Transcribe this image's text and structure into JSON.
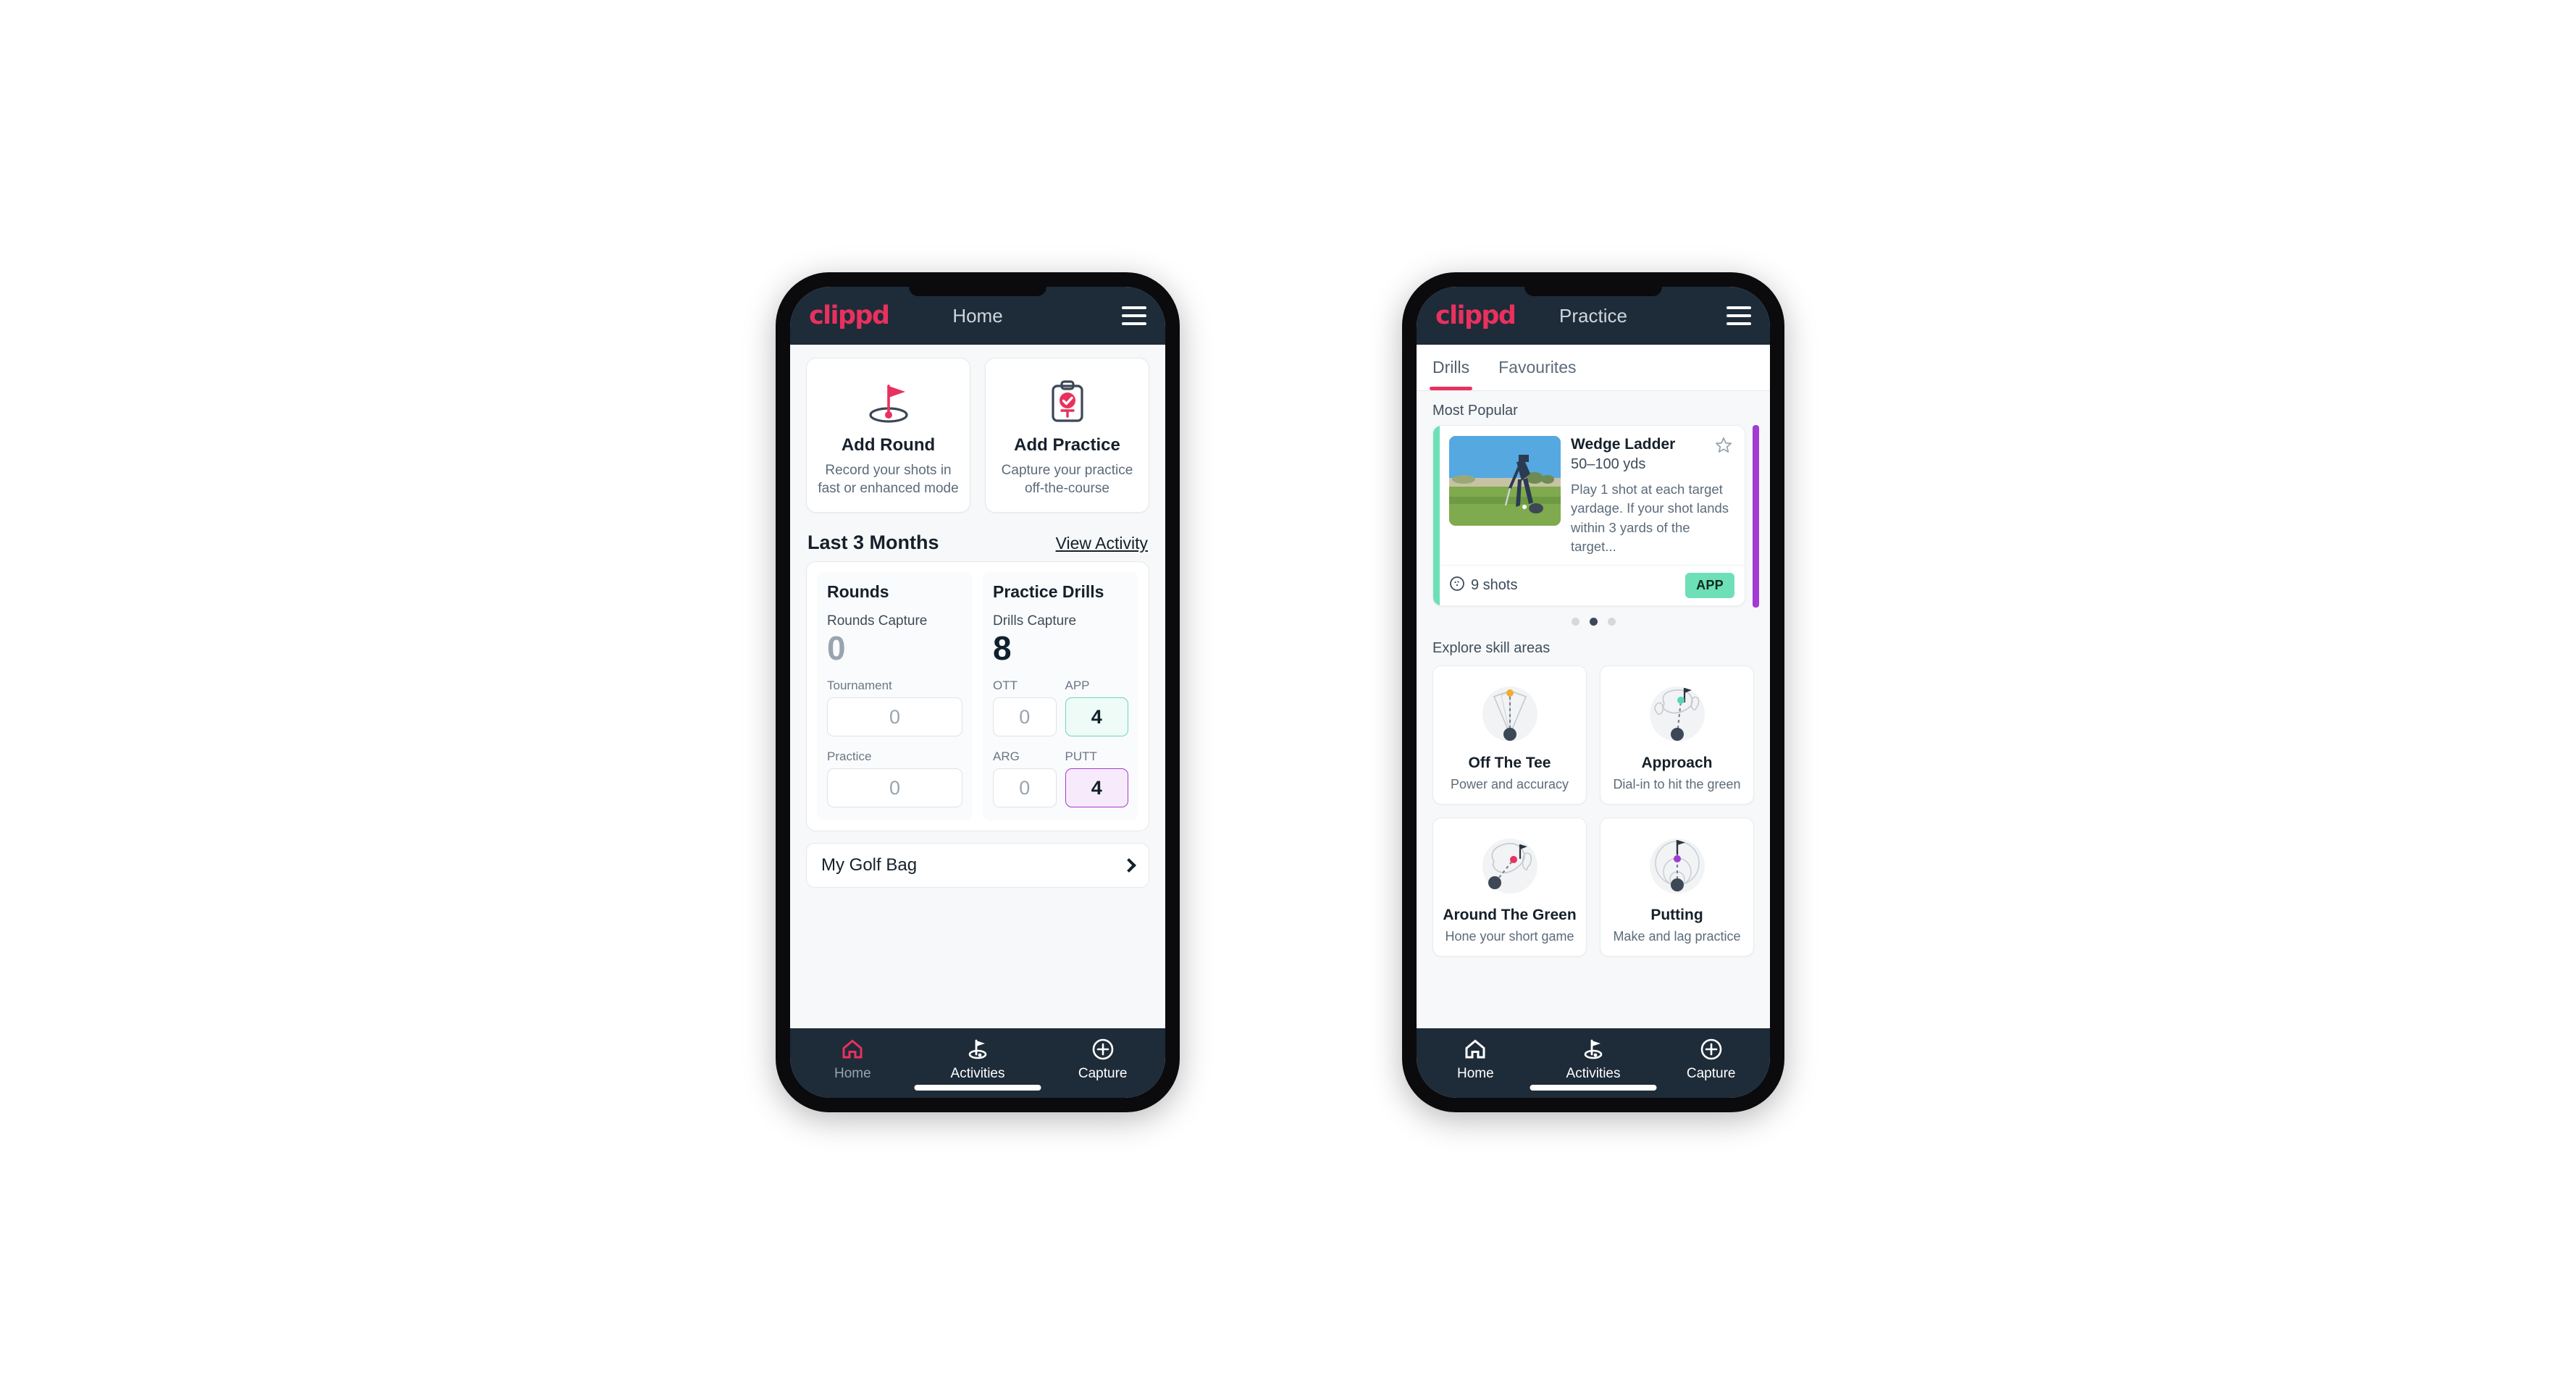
{
  "theme": {
    "brand_pink": "#e8315e",
    "navy": "#1e2b38",
    "app_green": "#6ee0b8",
    "putt_purple": "#a23bd4",
    "page_bg": "#ffffff"
  },
  "phone_home": {
    "appbar": {
      "logo": "clippd",
      "title": "Home",
      "menu_icon": "hamburger-menu-icon"
    },
    "actions": [
      {
        "icon": "golf-flag-hole-icon",
        "title": "Add Round",
        "subtitle": "Record your shots in fast or enhanced mode"
      },
      {
        "icon": "clipboard-check-icon",
        "title": "Add Practice",
        "subtitle": "Capture your practice off-the-course"
      }
    ],
    "section": {
      "title": "Last 3 Months",
      "link": "View Activity"
    },
    "rounds": {
      "heading": "Rounds",
      "capture_label": "Rounds Capture",
      "capture_value": "0",
      "fields": [
        {
          "label": "Tournament",
          "value": "0",
          "style": "plain"
        },
        {
          "label": "Practice",
          "value": "0",
          "style": "plain"
        }
      ]
    },
    "drills": {
      "heading": "Practice Drills",
      "capture_label": "Drills Capture",
      "capture_value": "8",
      "fields": [
        {
          "label": "OTT",
          "value": "0",
          "style": "plain"
        },
        {
          "label": "APP",
          "value": "4",
          "style": "app"
        },
        {
          "label": "ARG",
          "value": "0",
          "style": "plain"
        },
        {
          "label": "PUTT",
          "value": "4",
          "style": "putt"
        }
      ]
    },
    "golf_bag": {
      "label": "My Golf Bag",
      "chevron_icon": "chevron-right-icon"
    },
    "bottom_nav": [
      {
        "label": "Home",
        "icon": "home-icon",
        "active": true
      },
      {
        "label": "Activities",
        "icon": "golf-flag-icon",
        "active": false
      },
      {
        "label": "Capture",
        "icon": "plus-circle-icon",
        "active": false
      }
    ]
  },
  "phone_practice": {
    "appbar": {
      "logo": "clippd",
      "title": "Practice",
      "menu_icon": "hamburger-menu-icon"
    },
    "tabs": [
      {
        "label": "Drills",
        "active": true
      },
      {
        "label": "Favourites",
        "active": false
      }
    ],
    "most_popular_label": "Most Popular",
    "drill_card": {
      "accent_color": "#6ee0b8",
      "thumbnail": "golfer-chipping-photo",
      "name": "Wedge Ladder",
      "yardage": "50–100 yds",
      "description": "Play 1 shot at each target yardage. If your shot lands within 3 yards of the target...",
      "star_icon": "star-outline-icon",
      "shots_icon": "golf-ball-icon",
      "shots": "9 shots",
      "badge": "APP",
      "next_card_accent": "#a23bd4"
    },
    "carousel_dots": {
      "count": 3,
      "active_index": 1
    },
    "explore_label": "Explore skill areas",
    "skill_areas": [
      {
        "icon": "tee-shot-dispersion-icon",
        "title": "Off The Tee",
        "subtitle": "Power and accuracy",
        "dot_color": "#f0ad2e"
      },
      {
        "icon": "approach-green-icon",
        "title": "Approach",
        "subtitle": "Dial-in to hit the green",
        "dot_color": "#5ed6b4"
      },
      {
        "icon": "around-green-icon",
        "title": "Around The Green",
        "subtitle": "Hone your short game",
        "dot_color": "#e8315e"
      },
      {
        "icon": "putting-rings-icon",
        "title": "Putting",
        "subtitle": "Make and lag practice",
        "dot_color": "#a23bd4"
      }
    ],
    "bottom_nav": [
      {
        "label": "Home",
        "icon": "home-icon",
        "active": false
      },
      {
        "label": "Activities",
        "icon": "golf-flag-icon",
        "active": false
      },
      {
        "label": "Capture",
        "icon": "plus-circle-icon",
        "active": false
      }
    ]
  }
}
